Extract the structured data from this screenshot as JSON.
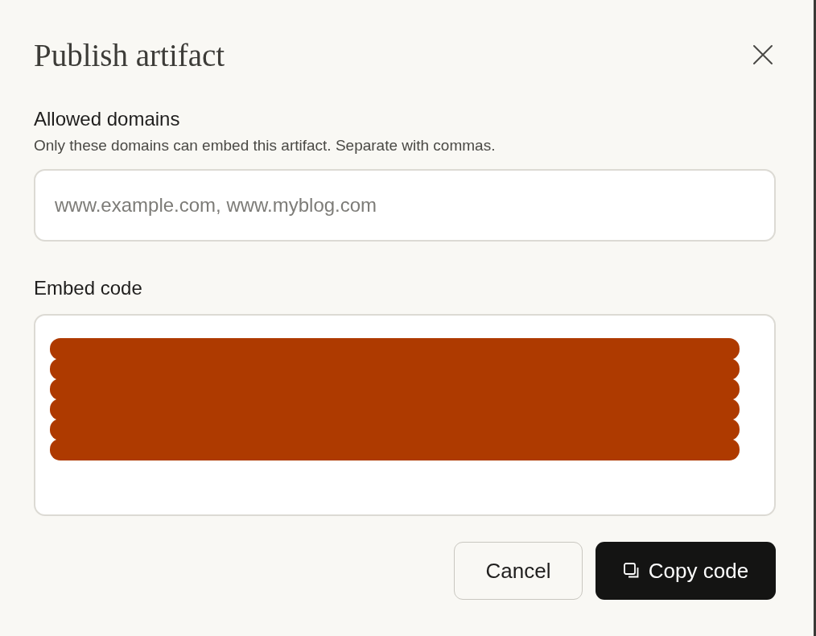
{
  "dialog": {
    "title": "Publish artifact"
  },
  "allowed_domains": {
    "label": "Allowed domains",
    "description": "Only these domains can embed this artifact. Separate with commas.",
    "placeholder": "www.example.com, www.myblog.com"
  },
  "embed_code": {
    "label": "Embed code",
    "redacted": true
  },
  "buttons": [
    {
      "label": "Cancel",
      "kind": "secondary"
    },
    {
      "label": "Copy code",
      "kind": "primary"
    }
  ]
}
